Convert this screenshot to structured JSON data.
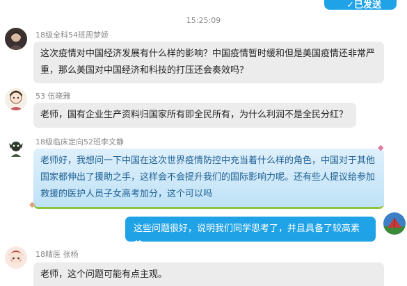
{
  "top_partial": {
    "label": "✓已发送"
  },
  "timestamp": "15:25:09",
  "messages": [
    {
      "sender": "18级全科54班周梦娇",
      "avatar_icon": "user-avatar-icon",
      "text": "这次疫情对中国经济发展有什么样的影响？中国疫情暂时缓和但是美国疫情还非常严重，那么美国对中国经济和科技的打压还会奏效吗？"
    },
    {
      "sender": "53  伍晓雅",
      "avatar_icon": "user-avatar-icon",
      "text": "老师，国有企业生产资料归国家所有即全民所有，为什么利润不是全民分红？"
    },
    {
      "sender": "18级临床定向52班李文静",
      "avatar_icon": "user-avatar-icon",
      "text": "老师好，我想问一下中国在这次世界疫情防控中充当着什么样的角色，中国对于其他国家都伸出了援助之手，这样会不会提升我们的国际影响力呢。还有些人提议给参加救援的医护人员子女高考加分，这个可以吗"
    },
    {
      "sender": "",
      "avatar_icon": "teacher-avatar-icon",
      "text": "这些问题很好，说明我们同学思考了，并且具备了较高素养"
    },
    {
      "sender": "18精医 张杨",
      "avatar_icon": "user-avatar-icon",
      "text": "老师，这个问题可能有点主观。"
    }
  ],
  "colors": {
    "outgoing_bubble": "#1fa2e6",
    "incoming_bubble": "#ececec",
    "fancy_bubble_text": "#1d5f92"
  }
}
